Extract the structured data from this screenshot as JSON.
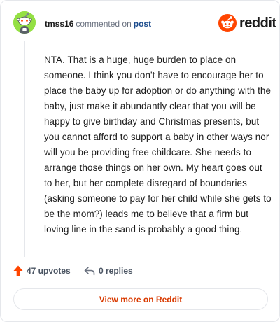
{
  "header": {
    "username": "tmss16",
    "action_text": "commented on",
    "post_link": "post"
  },
  "brand": {
    "wordmark": "reddit",
    "accent_color": "#ff4500"
  },
  "comment": {
    "body": "NTA. That is a huge, huge burden to place on someone. I think you don't have to encourage her to place the baby up for adoption or do anything with the baby, just make it abundantly clear that you will be happy to give birthday and Christmas presents, but you cannot afford to support a baby in other ways nor will you be providing free childcare. She needs to arrange those things on her own. My heart goes out to her, but her complete disregard of boundaries (asking someone to pay for her child while she gets to be the mom?) leads me to believe that a firm but loving line in the sand is probably a good thing."
  },
  "actions": {
    "upvotes_label": "47 upvotes",
    "upvote_icon": "arrow-up-icon",
    "upvote_color": "#ff4500",
    "replies_label": "0 replies",
    "reply_icon": "reply-arrow-icon"
  },
  "footer": {
    "view_more_label": "View more on Reddit",
    "view_more_color": "#d93a00"
  },
  "avatar": {
    "background_color": "#94e044",
    "icon": "snoo-avatar-icon"
  }
}
